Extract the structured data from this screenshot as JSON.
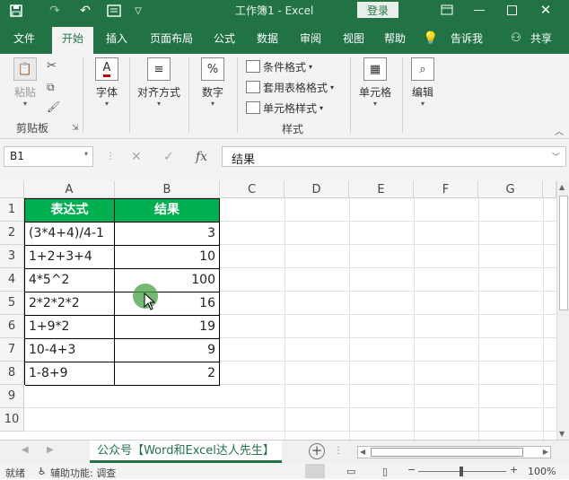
{
  "titlebar": {
    "title": "工作簿1  -  Excel",
    "login": "登录",
    "qa_icons": [
      "save-icon",
      "redo-icon",
      "undo-icon",
      "print-preview-icon",
      "customize-icon"
    ]
  },
  "tabs": [
    "文件",
    "开始",
    "插入",
    "页面布局",
    "公式",
    "数据",
    "审阅",
    "视图",
    "帮助",
    "告诉我",
    "共享"
  ],
  "active_tab": "开始",
  "ribbon": {
    "clipboard": {
      "paste": "粘贴",
      "group": "剪贴板"
    },
    "font": "字体",
    "align": "对齐方式",
    "number": "数字",
    "styles": {
      "cond": "条件格式",
      "table": "套用表格格式",
      "cell": "单元格样式",
      "group": "样式"
    },
    "cells": "单元格",
    "edit": "编辑"
  },
  "formula_bar": {
    "name_box": "B1",
    "fx": "fx",
    "value": "结果"
  },
  "columns": [
    "A",
    "B",
    "C",
    "D",
    "E",
    "F",
    "G"
  ],
  "rows": [
    "1",
    "2",
    "3",
    "4",
    "5",
    "6",
    "7",
    "8",
    "9",
    "10"
  ],
  "table": {
    "headers": [
      "表达式",
      "结果"
    ],
    "rows": [
      [
        "(3*4+4)/4-1",
        "3"
      ],
      [
        "1+2+3+4",
        "10"
      ],
      [
        "4*5^2",
        "100"
      ],
      [
        "2*2*2*2",
        "16"
      ],
      [
        "1+9*2",
        "19"
      ],
      [
        "10-4+3",
        "9"
      ],
      [
        "1-8+9",
        "2"
      ]
    ]
  },
  "sheet_tab": "公众号【Word和Excel达人先生】",
  "status": {
    "ready": "就绪",
    "accessibility": "辅助功能: 调查",
    "zoom": "100%"
  },
  "colors": {
    "excel_green": "#217346",
    "header_fill": "#00b050"
  }
}
